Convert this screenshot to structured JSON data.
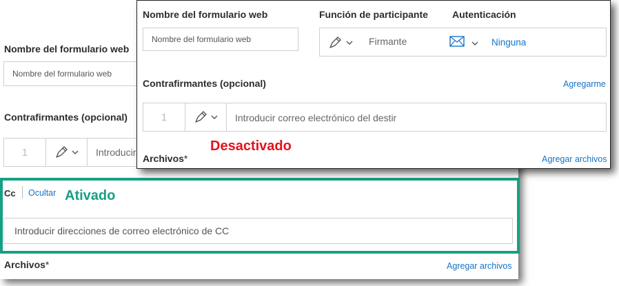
{
  "back": {
    "webform_name_label": "Nombre del formulario web",
    "webform_name_placeholder": "Nombre del formulario web",
    "countersigners_label": "Contrafirmantes (opcional)",
    "counter_row_number": "1",
    "counter_email_placeholder": "Introducir",
    "cc_label": "Cc",
    "cc_hide_link": "Ocultar",
    "cc_placeholder": "Introducir direcciones de correo electrónico de CC",
    "files_label": "Archivos",
    "required_mark": "*",
    "add_files_link": "Agregar archivos"
  },
  "front": {
    "webform_name_label": "Nombre del formulario web",
    "webform_name_placeholder": "Nombre del formulario web",
    "participant_role_label": "Función de participante",
    "role_value": "Firmante",
    "authentication_label": "Autenticación",
    "auth_value": "Ninguna",
    "countersigners_label": "Contrafirmantes (opcional)",
    "add_me_link": "Agregarme",
    "counter_row_number": "1",
    "counter_email_placeholder": "Introducir correo electrónico del destir",
    "files_label": "Archivos",
    "required_mark": "*",
    "add_files_link": "Agregar archivos"
  },
  "annotations": {
    "enabled": "Ativado",
    "disabled": "Desactivado"
  },
  "colors": {
    "link": "#1473c7",
    "enabled": "#16a085",
    "disabled": "#e3121c"
  },
  "icons": {
    "pen": "pen-icon",
    "chevron": "chevron-down-icon",
    "mail": "mail-icon"
  }
}
